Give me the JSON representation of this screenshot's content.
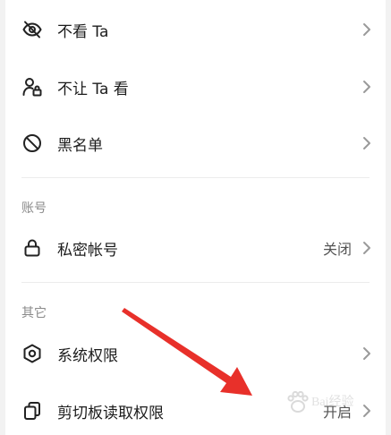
{
  "rows": {
    "hide_their_posts": {
      "label": "不看 Ta"
    },
    "hide_my_posts": {
      "label": "不让 Ta 看"
    },
    "blacklist": {
      "label": "黑名单"
    },
    "private_account": {
      "label": "私密帐号",
      "value": "关闭"
    },
    "system_permissions": {
      "label": "系统权限"
    },
    "clipboard_permissions": {
      "label": "剪切板读取权限",
      "value": "开启"
    }
  },
  "sections": {
    "account": "账号",
    "other": "其它"
  },
  "icons": {
    "hide_their_posts": "eye-off-icon",
    "hide_my_posts": "user-lock-icon",
    "blacklist": "block-icon",
    "private_account": "lock-icon",
    "system_permissions": "hexagon-settings-icon",
    "clipboard_permissions": "clipboard-copy-icon",
    "chevron": "chevron-right-icon"
  },
  "annotation": {
    "color": "#e8302a"
  },
  "watermark": {
    "text": "Bai经验"
  }
}
